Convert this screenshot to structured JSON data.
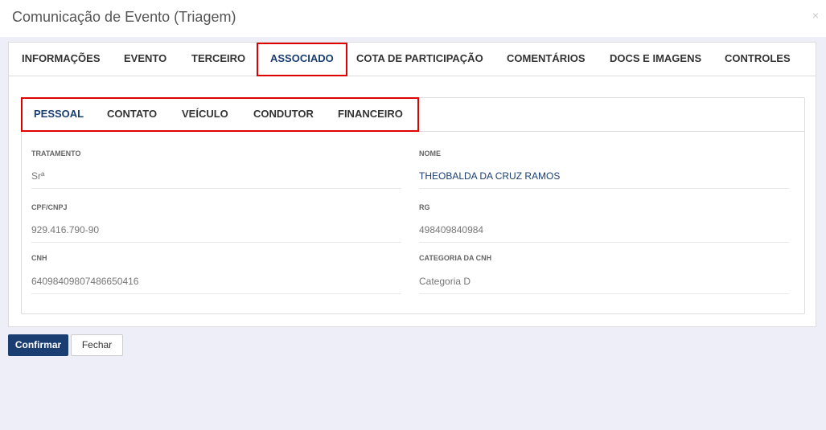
{
  "modal": {
    "title": "Comunicação de Evento (Triagem)",
    "close_icon": "×"
  },
  "main_tabs": [
    {
      "label": "INFORMAÇÕES"
    },
    {
      "label": "EVENTO"
    },
    {
      "label": "TERCEIRO"
    },
    {
      "label": "ASSOCIADO",
      "active": true
    },
    {
      "label": "COTA DE PARTICIPAÇÃO"
    },
    {
      "label": "COMENTÁRIOS"
    },
    {
      "label": "DOCS E IMAGENS"
    },
    {
      "label": "CONTROLES"
    }
  ],
  "sub_tabs": [
    {
      "label": "PESSOAL",
      "active": true
    },
    {
      "label": "CONTATO"
    },
    {
      "label": "VEÍCULO"
    },
    {
      "label": "CONDUTOR"
    },
    {
      "label": "FINANCEIRO"
    }
  ],
  "fields": {
    "tratamento": {
      "label": "TRATAMENTO",
      "value": "Srª"
    },
    "nome": {
      "label": "NOME",
      "value": "THEOBALDA DA CRUZ RAMOS"
    },
    "cpf": {
      "label": "CPF/CNPJ",
      "value": "929.416.790-90"
    },
    "rg": {
      "label": "RG",
      "value": "498409840984"
    },
    "cnh": {
      "label": "CNH",
      "value": "64098409807486650416"
    },
    "categoria_cnh": {
      "label": "CATEGORIA DA CNH",
      "value": "Categoria D"
    }
  },
  "buttons": {
    "confirm": "Confirmar",
    "close": "Fechar"
  },
  "colors": {
    "accent": "#1a3e72",
    "highlight": "#e00000",
    "background": "#eeeef8"
  }
}
